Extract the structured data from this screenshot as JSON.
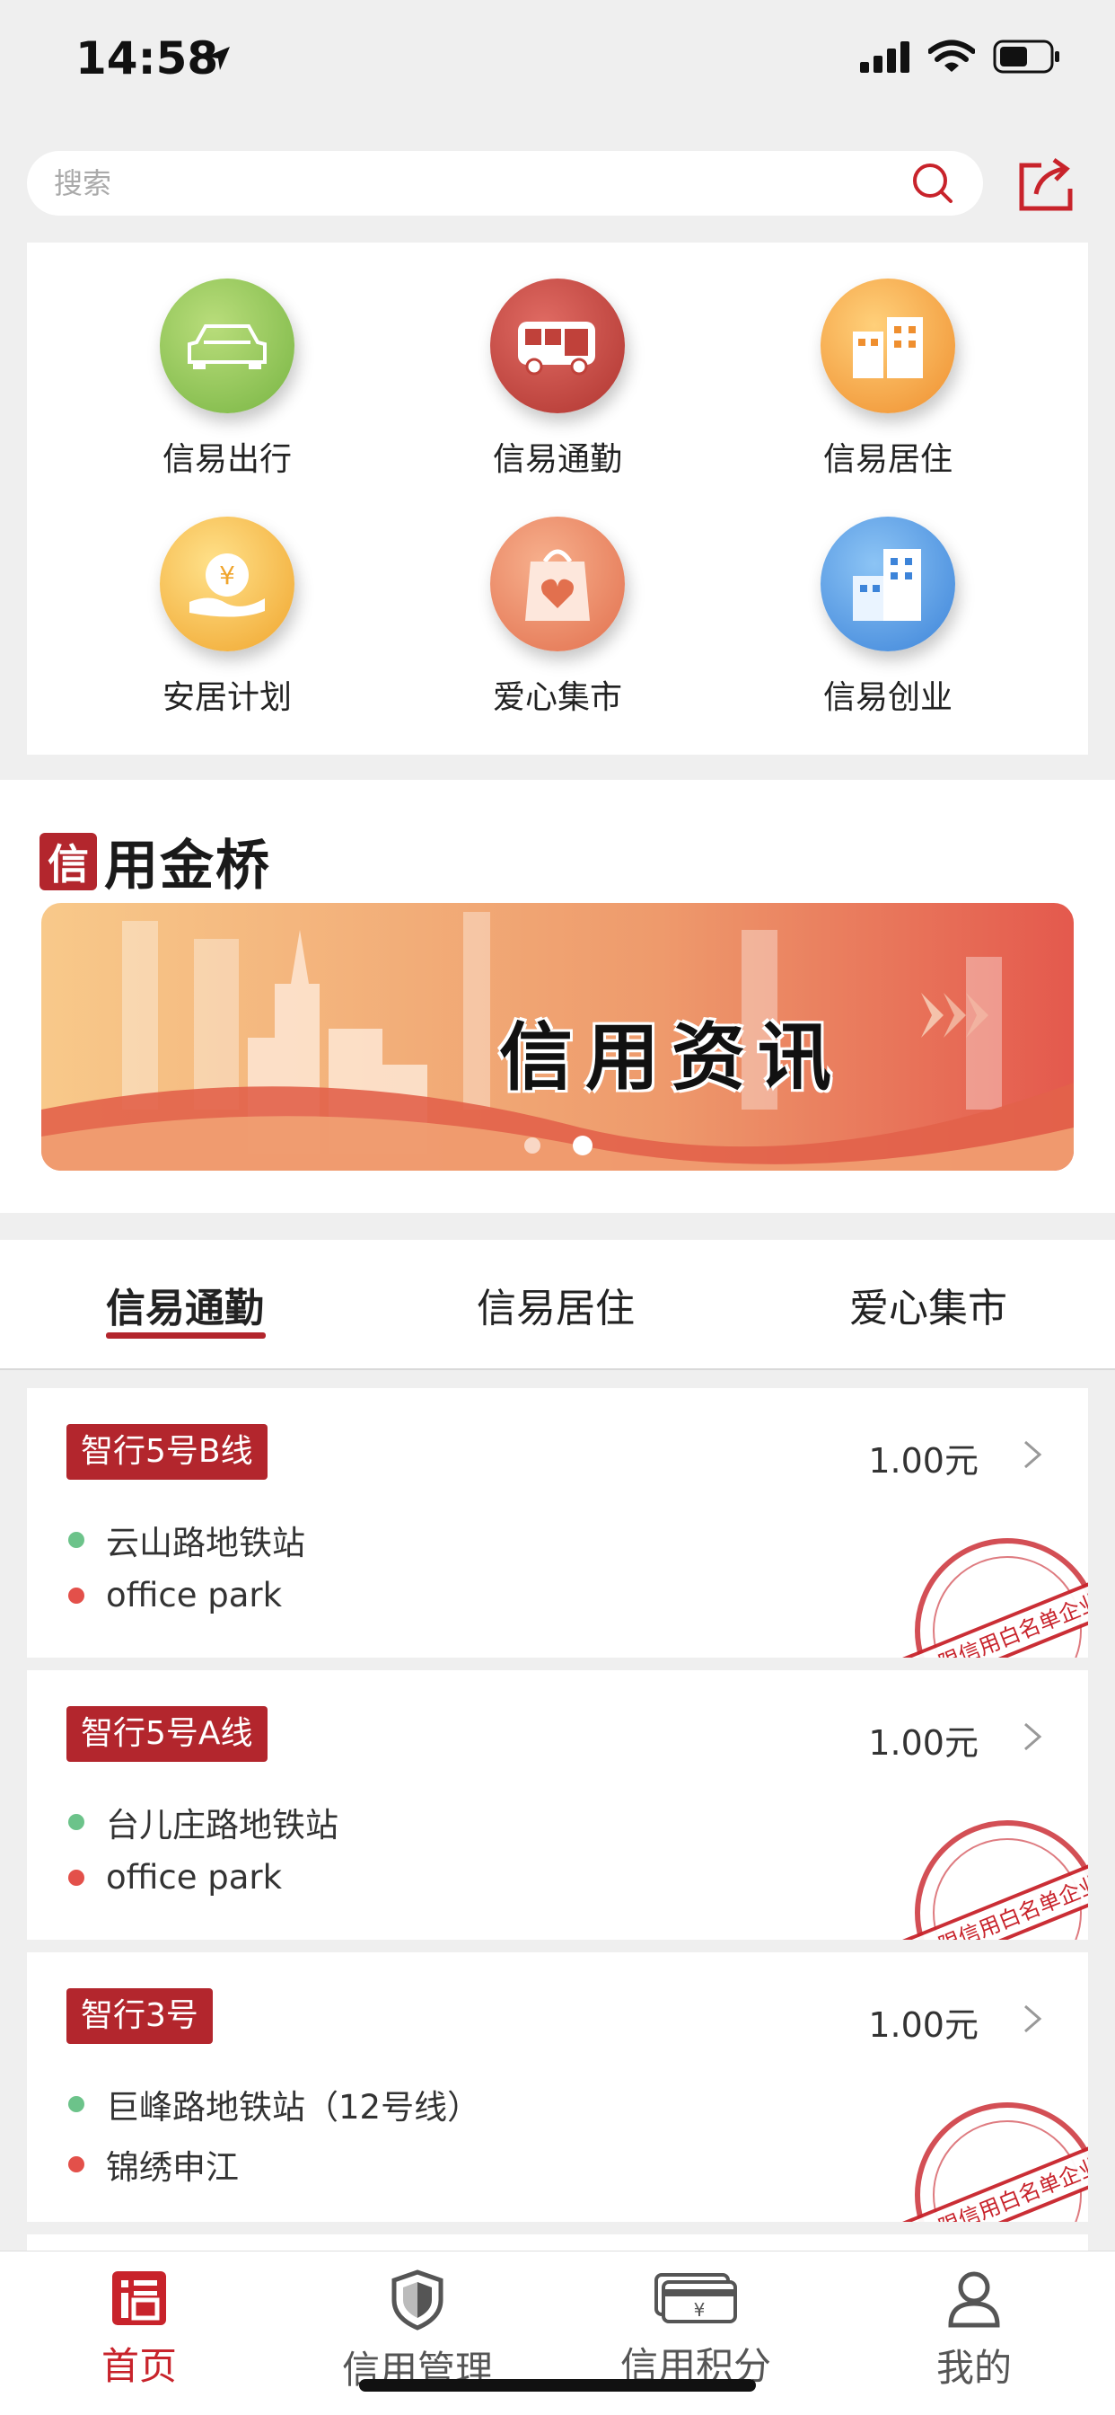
{
  "status_bar": {
    "time": "14:58"
  },
  "search": {
    "placeholder": "搜索"
  },
  "services": [
    {
      "label": "信易出行",
      "icon": "car-icon",
      "color": "#8cc152"
    },
    {
      "label": "信易通勤",
      "icon": "bus-icon",
      "color": "#c0413a"
    },
    {
      "label": "信易居住",
      "icon": "buildings-icon",
      "color": "#f0a33c"
    },
    {
      "label": "安居计划",
      "icon": "yuan-hand-icon",
      "color": "#f2b538"
    },
    {
      "label": "爱心集市",
      "icon": "heart-bag-icon",
      "color": "#ec8a63"
    },
    {
      "label": "信易创业",
      "icon": "office-building-icon",
      "color": "#4a90e2"
    }
  ],
  "brand": {
    "logo_char": "信",
    "name": "用金桥"
  },
  "banner": {
    "title": "信用资讯"
  },
  "tabs": [
    {
      "label": "信易通勤",
      "active": true
    },
    {
      "label": "信易居住",
      "active": false
    },
    {
      "label": "爱心集市",
      "active": false
    }
  ],
  "routes": [
    {
      "name": "智行5号B线",
      "price": "1.00元",
      "from": "云山路地铁站",
      "to": "office park"
    },
    {
      "name": "智行5号A线",
      "price": "1.00元",
      "from": "台儿庄路地铁站",
      "to": "office park"
    },
    {
      "name": "智行3号",
      "price": "1.00元",
      "from": "巨峰路地铁站（12号线）",
      "to": "锦绣申江"
    }
  ],
  "stamp": {
    "text": "仅限信用白名单企业"
  },
  "bottom_nav": [
    {
      "label": "首页",
      "icon": "home-credit-icon",
      "active": true
    },
    {
      "label": "信用管理",
      "icon": "shield-icon",
      "active": false
    },
    {
      "label": "信用积分",
      "icon": "points-card-icon",
      "active": false
    },
    {
      "label": "我的",
      "icon": "user-icon",
      "active": false
    }
  ],
  "colors": {
    "accent": "#b3262d",
    "active_nav": "#c8232b"
  }
}
